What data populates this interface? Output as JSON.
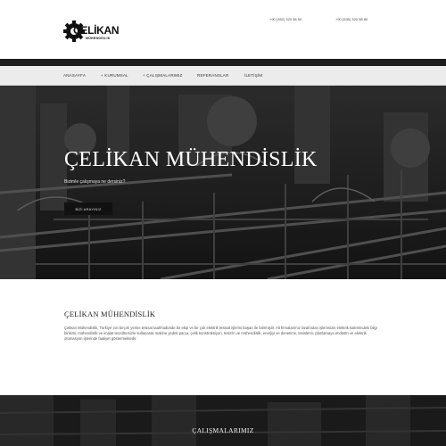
{
  "header": {
    "logo_text": "ÇELİKAN",
    "logo_sub": "MÜHENDİSLİK",
    "phone_1": "+90 (352) 320 38 54",
    "phone_2": "+90 (535) 320 38 80"
  },
  "nav": {
    "items": [
      {
        "label": "ANASAYFA"
      },
      {
        "label": "+ KURUMSAL"
      },
      {
        "label": "+ ÇALIŞMALARIMIZ"
      },
      {
        "label": "REFERANSLAR"
      },
      {
        "label": "İLETİŞİM"
      }
    ]
  },
  "hero": {
    "title": "ÇELİKAN MÜHENDİSLİK",
    "subtitle": "Bizimle çalışmaya ne dersiniz?",
    "button_label": "BİZİ ARAYINIZ"
  },
  "about": {
    "title": "ÇELİKAN MÜHENDİSLİK",
    "text": "Çelikan Mühendislik, Türkiye' nin birçok yerine tesisat taahhüdünde bir ekip ve bir çok elektrik tesisat işlerini başarı ile bitirmiştir. Alt firmalarımız tarafından işlerimizin elektrik kalemindeki bilgi birikimi, mühendislik ve imalat tecrübemizle kullanarak makine yedek parça, çelik konstrüksiyon, tesis'in ve mühendislik, enerjiyi ve denetime, tesislerin, planlamaya endüstri ve elektrik otomasyon işlerinde faaliyet göstermektedir."
  },
  "works": {
    "title": "ÇALIŞMALARIMIZ"
  },
  "colors": {
    "topbar": "#1c1c1c",
    "nav_bg": "#ececec",
    "button_bg": "#111111"
  }
}
